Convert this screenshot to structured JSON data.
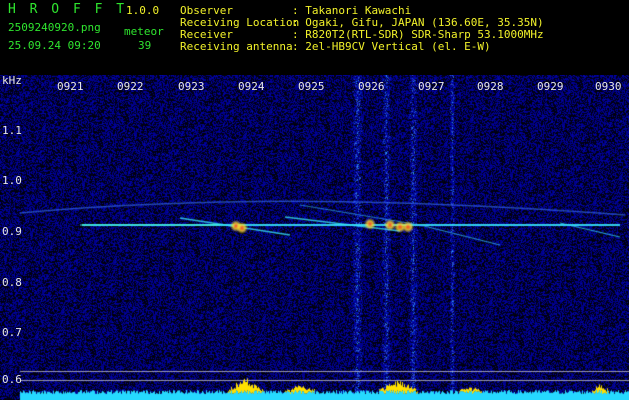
{
  "app": {
    "logo": "H R O F F T",
    "version": "1.0.0",
    "filename": "2509240920.png",
    "count_label": "meteor",
    "datetime": "25.09.24 09:20",
    "count": "39"
  },
  "info": [
    {
      "label": "Observer",
      "value": ": Takanori Kawachi"
    },
    {
      "label": "Receiving Location",
      "value": ": Ogaki, Gifu, JAPAN (136.60E, 35.35N)"
    },
    {
      "label": "Receiver",
      "value": ": R820T2(RTL-SDR) SDR-Sharp 53.1000MHz"
    },
    {
      "label": "Receiving antenna",
      "value": ": 2el-HB9CV Vertical (el. E-W)"
    }
  ],
  "axis": {
    "unit": "kHz",
    "time_ticks": [
      "0921",
      "0922",
      "0923",
      "0924",
      "0925",
      "0926",
      "0927",
      "0928",
      "0929",
      "0930"
    ],
    "freq_ticks": [
      "1.1",
      "1.0",
      "0.9",
      "0.8",
      "0.7",
      "0.6"
    ]
  },
  "colors": {
    "background": "#000000",
    "header_green": "#2fe52f",
    "header_yellow": "#f2f22a",
    "noise_blue": "#1a2bd0",
    "signal_cyan": "#38e8ff",
    "meteor_yellow": "#ffe000"
  }
}
